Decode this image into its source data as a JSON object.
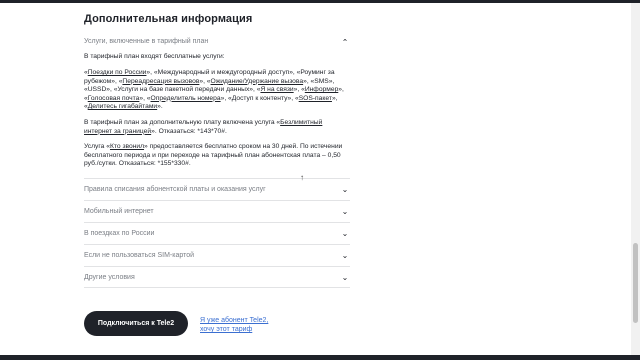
{
  "section": {
    "title": "Дополнительная информация"
  },
  "accordion_open": {
    "title": "Услуги, включенные в тарифный план",
    "p1": "В тарифный план входят бесплатные услуги:",
    "p2": {
      "t1": "«",
      "l1": "Поездки по России",
      "t2": "», «Международный и междугородный доступ», «Роуминг за рубежом», «",
      "l2": "Переадресация вызовов",
      "t3": "», «",
      "l3": "Ожидание/Удержание вызова",
      "t4": "», «SMS», «USSD», «Услуги на базе пакетной передачи данных», «",
      "l4": "Я на связи",
      "t5": "», «",
      "l5": "Информер",
      "t6": "», «",
      "l6": "Голосовая почта",
      "t7": "», «",
      "l7": "Определитель номера",
      "t8": "», «Доступ к контенту», «",
      "l8": "SOS-пакет",
      "t9": "», «",
      "l9": "Делитесь гигабайтами",
      "t10": "»."
    },
    "p3": {
      "t1": "В тарифный план за дополнительную плату включена услуга «",
      "l1": "Безлимитный интернет за границей",
      "t2": "». Отказаться: *143*70#."
    },
    "p4": {
      "t1": "Услуга «",
      "l1": "Кто звонил",
      "t2": "» предоставляется бесплатно сроком на 30 дней. По истечении бесплатного периода и при переходе на тарифный план абонентская плата – 0,50 руб./сутки. Отказаться: *155*330#."
    }
  },
  "accordion_items": [
    "Правила списания абонентской платы и оказания услуг",
    "Мобильный интернет",
    "В поездках по России",
    "Если не пользоваться SIM-картой",
    "Другие условия"
  ],
  "cta": {
    "connect_label": "Подключиться к Tele2",
    "subscriber_link": "Я уже абонент Tele2, хочу этот тариф"
  },
  "icons": {
    "chevron_up": "chevron-up-icon",
    "chevron_down": "chevron-down-icon"
  }
}
